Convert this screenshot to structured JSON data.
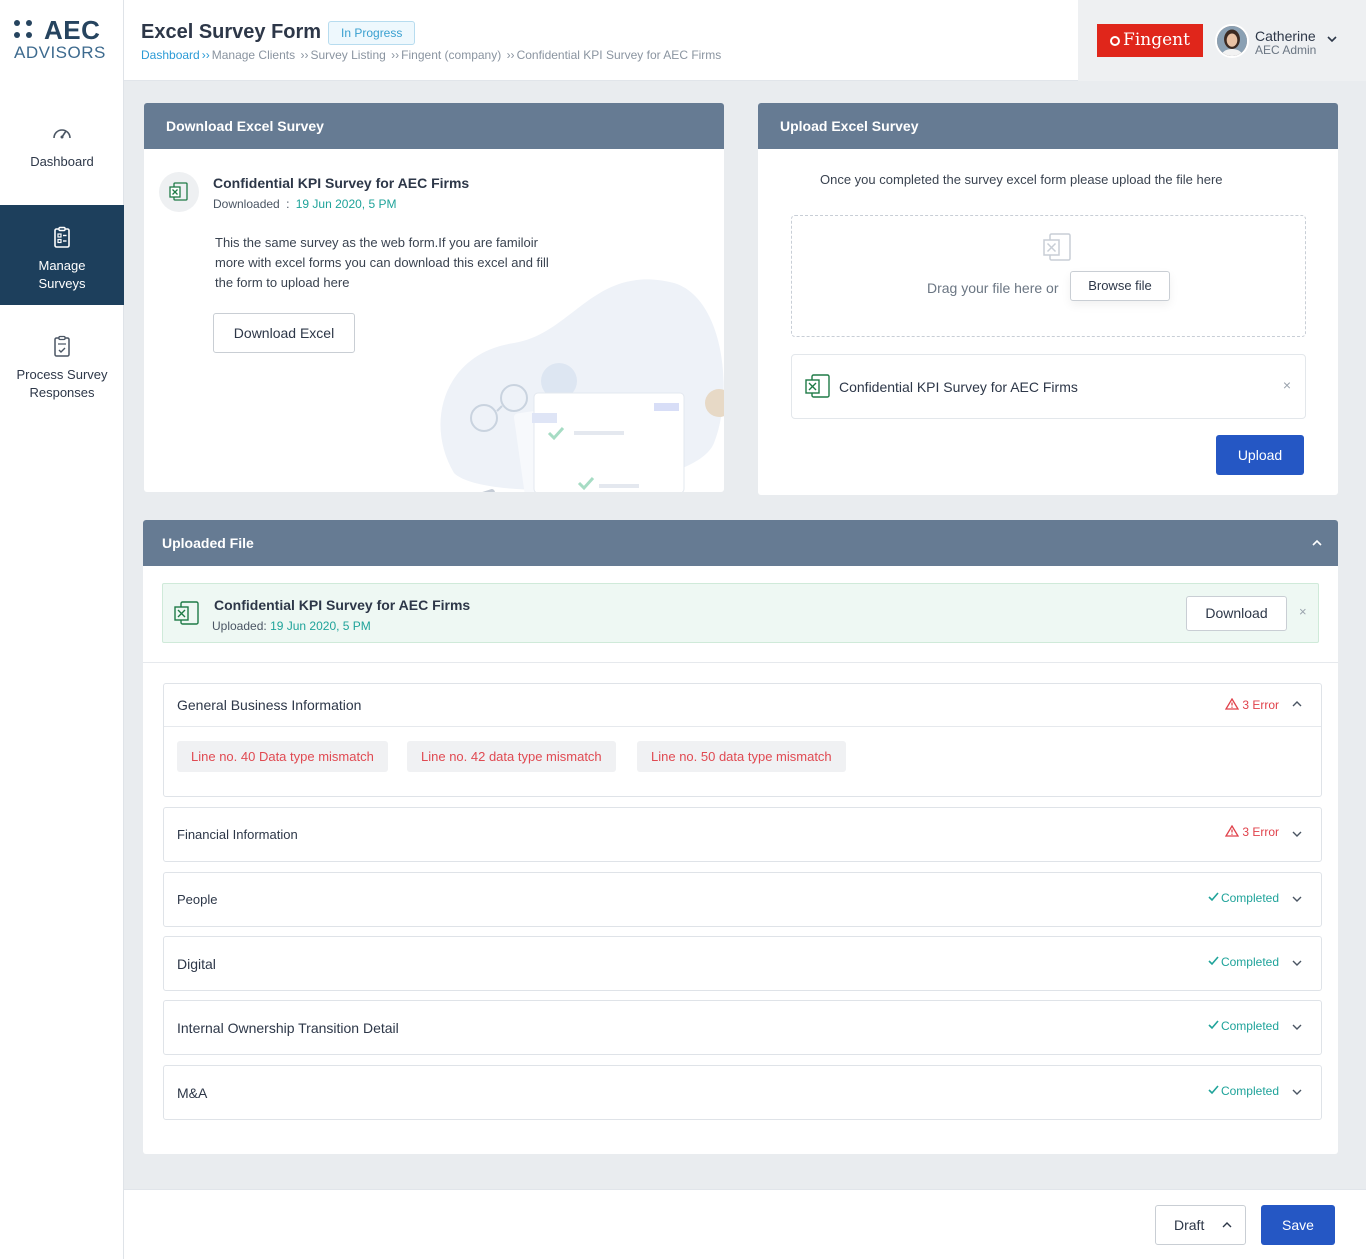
{
  "brand": {
    "logo_top": "AEC",
    "logo_bottom": "ADVISORS"
  },
  "sidebar": {
    "items": [
      {
        "label": "Dashboard",
        "icon": "gauge-icon",
        "active": false
      },
      {
        "label": "Manage Surveys",
        "icon": "clipboard-list-icon",
        "active": true
      },
      {
        "label": "Process Survey Responses",
        "icon": "clipboard-check-icon",
        "active": false
      }
    ]
  },
  "header": {
    "title": "Excel Survey Form",
    "status": "In Progress",
    "breadcrumb": [
      "Dashboard",
      "Manage Clients",
      "Survey Listing",
      "Fingent (company)",
      "Confidential KPI Survey for AEC Firms"
    ],
    "breadcrumb_sep_first": "››",
    "breadcrumb_sep": "››",
    "company_logo": "Fingent",
    "user": {
      "name": "Catherine",
      "role": "AEC Admin"
    }
  },
  "download_card": {
    "title": "Download Excel Survey",
    "file_name": "Confidential KPI Survey for AEC Firms",
    "downloaded_label": "Downloaded",
    "downloaded_sep": ":",
    "downloaded_date": "19 Jun 2020, 5 PM",
    "description": "This the same survey as the web form.If you are familoir more with excel forms you can download this excel and fill the form to upload here",
    "button": "Download Excel"
  },
  "upload_card": {
    "title": "Upload Excel Survey",
    "help": "Once you completed the survey excel form please upload the file here",
    "drop_text": "Drag your file here or",
    "browse_button": "Browse file",
    "file_name": "Confidential KPI Survey for AEC Firms",
    "remove_icon": "×",
    "upload_button": "Upload"
  },
  "uploaded_panel": {
    "title": "Uploaded File",
    "file_name": "Confidential KPI Survey for AEC Firms",
    "uploaded_label": "Uploaded:",
    "uploaded_date": "19 Jun 2020, 5 PM",
    "download_button": "Download",
    "remove_icon": "×",
    "sections": [
      {
        "title": "General Business Information",
        "status": "3 Error",
        "state": "error",
        "expanded": true,
        "errors": [
          "Line no. 40 Data type mismatch",
          "Line no. 42 data type mismatch",
          "Line no. 50 data type mismatch"
        ]
      },
      {
        "title": "Financial Information",
        "status": "3 Error",
        "state": "error",
        "expanded": false
      },
      {
        "title": "People",
        "status": "Completed",
        "state": "complete",
        "expanded": false
      },
      {
        "title": "Digital",
        "status": "Completed",
        "state": "complete",
        "expanded": false
      },
      {
        "title": "Internal Ownership Transition Detail",
        "status": "Completed",
        "state": "complete",
        "expanded": false
      },
      {
        "title": "M&A",
        "status": "Completed",
        "state": "complete",
        "expanded": false
      }
    ]
  },
  "footer": {
    "draft_label": "Draft",
    "save_label": "Save"
  },
  "colors": {
    "primary": "#2557c4",
    "sidebar_active": "#1d3f5c",
    "card_head": "#667b93",
    "error": "#e0424b",
    "success": "#1fa39a"
  }
}
